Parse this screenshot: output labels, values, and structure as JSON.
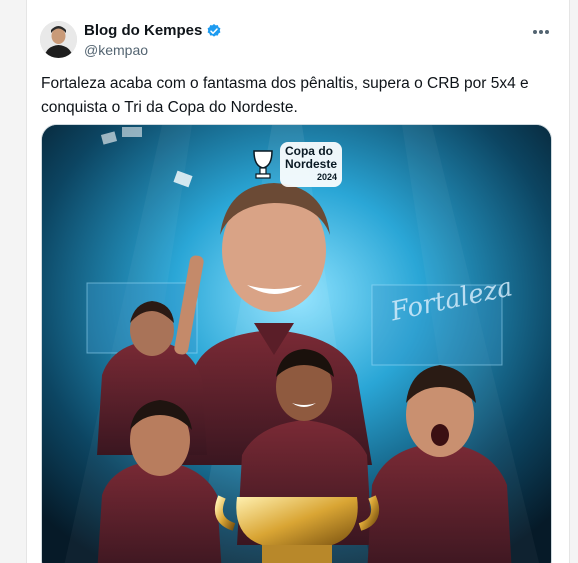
{
  "tweet": {
    "author_name": "Blog do Kempes",
    "author_handle": "@kempao",
    "text": "Fortaleza acaba com o fantasma dos pênaltis, supera o CRB por 5x4 e conquista o Tri da Copa do Nordeste.",
    "verified": true
  },
  "media": {
    "logo_line1": "Copa do",
    "logo_line2": "Nordeste",
    "logo_year": "2024",
    "signature": "Fortaleza"
  },
  "icons": {
    "verified": "verified-badge-icon",
    "more": "more-options-icon"
  },
  "colors": {
    "verified": "#1d9bf0",
    "text": "#0f1419",
    "secondary": "#536471"
  }
}
